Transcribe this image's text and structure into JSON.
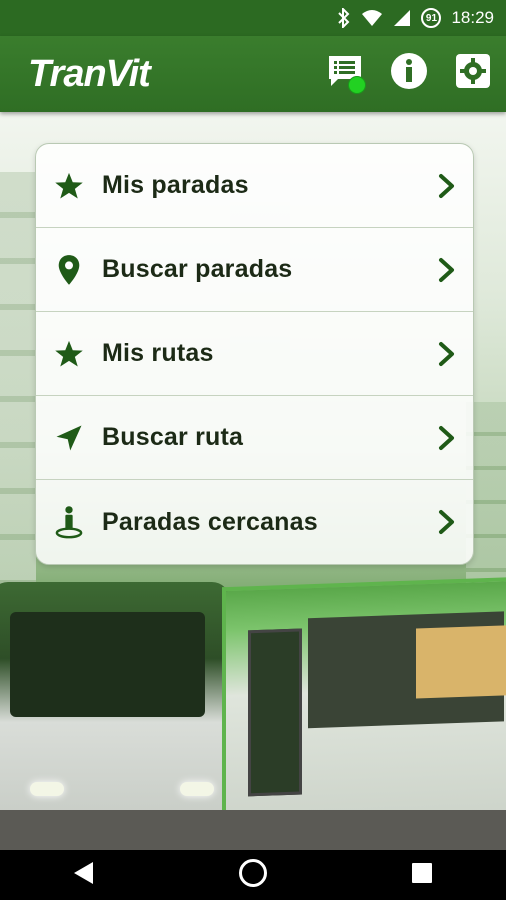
{
  "status_bar": {
    "time": "18:29",
    "battery_badge": "91",
    "icons": [
      "bluetooth-icon",
      "wifi-icon",
      "signal-icon",
      "battery-icon"
    ]
  },
  "app_bar": {
    "title": "TranVit",
    "actions": [
      "messages-icon",
      "info-icon",
      "settings-icon"
    ],
    "notification_color": "#22d122"
  },
  "menu": {
    "items": [
      {
        "label": "Mis paradas",
        "icon": "star-icon"
      },
      {
        "label": "Buscar paradas",
        "icon": "location-pin-icon"
      },
      {
        "label": "Mis rutas",
        "icon": "star-icon"
      },
      {
        "label": "Buscar ruta",
        "icon": "navigation-arrow-icon"
      },
      {
        "label": "Paradas cercanas",
        "icon": "person-location-icon"
      }
    ]
  },
  "nav_bar": {
    "buttons": [
      "back-icon",
      "home-icon",
      "recents-icon"
    ]
  },
  "colors": {
    "primary": "#2f6e24",
    "icon_green": "#1f5a17",
    "menu_text": "#1c2a16"
  }
}
